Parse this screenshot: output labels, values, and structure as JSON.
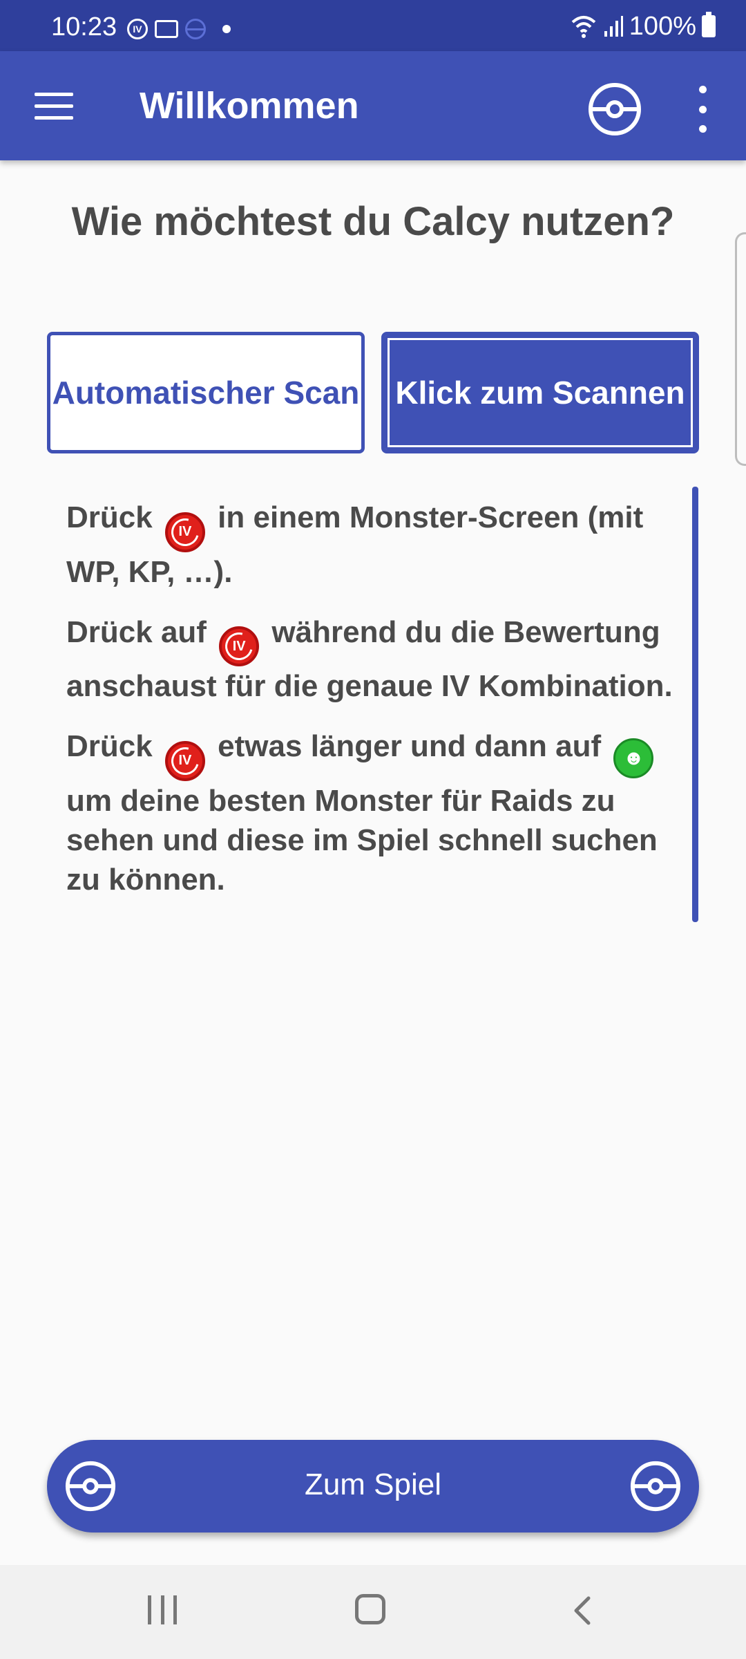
{
  "status_bar": {
    "time": "10:23",
    "iv_notification_label": "IV",
    "battery": "100%"
  },
  "app_bar": {
    "title": "Willkommen"
  },
  "main": {
    "question": "Wie möchtest du Calcy nutzen?",
    "modes": [
      {
        "label": "Automatischer Scan",
        "selected": false
      },
      {
        "label": "Klick zum Scannen",
        "selected": true
      }
    ],
    "icon_label": "IV",
    "instructions": {
      "p1_before": "Drück ",
      "p1_after": " in einem Monster-Screen (mit WP, KP, …).",
      "p2_before": "Drück auf ",
      "p2_after": " während du die Bewertung anschaust für die genaue IV Kombination.",
      "p3_before": "Drück ",
      "p3_middle": " etwas länger und dann auf ",
      "p3_after": " um deine besten Monster für Raids zu sehen und diese im Spiel schnell suchen zu können."
    }
  },
  "bottom": {
    "game_button_label": "Zum Spiel"
  },
  "colors": {
    "primary": "#3f51b5",
    "status_bar": "#2f3f9c",
    "iv_red": "#e0201b",
    "raid_green": "#2cbd38"
  }
}
